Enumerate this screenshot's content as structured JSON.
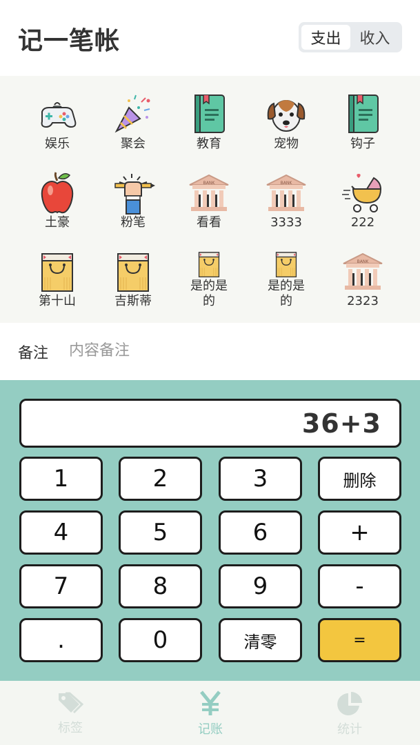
{
  "header": {
    "title": "记一笔帐",
    "toggle": {
      "expense": "支出",
      "income": "收入",
      "active": "expense"
    }
  },
  "categories": [
    {
      "label": "娱乐",
      "icon": "gamepad-icon"
    },
    {
      "label": "聚会",
      "icon": "party-popper-icon"
    },
    {
      "label": "教育",
      "icon": "book-icon"
    },
    {
      "label": "宠物",
      "icon": "dog-icon"
    },
    {
      "label": "钩子",
      "icon": "book-icon"
    },
    {
      "label": "土豪",
      "icon": "apple-icon"
    },
    {
      "label": "粉笔",
      "icon": "hand-pencil-icon"
    },
    {
      "label": "看看",
      "icon": "bank-icon"
    },
    {
      "label": "3333",
      "icon": "bank-icon"
    },
    {
      "label": "222",
      "icon": "stroller-icon"
    },
    {
      "label": "第十山",
      "icon": "shopping-bag-icon"
    },
    {
      "label": "吉斯蒂",
      "icon": "shopping-bag-icon"
    },
    {
      "label": "是的是的",
      "icon": "shopping-bag-icon"
    },
    {
      "label": "是的是的",
      "icon": "shopping-bag-icon"
    },
    {
      "label": "2323",
      "icon": "bank-icon"
    }
  ],
  "remark": {
    "label": "备注",
    "placeholder": "内容备注"
  },
  "keypad": {
    "display": "36+3",
    "keys": [
      "1",
      "2",
      "3",
      "删除",
      "4",
      "5",
      "6",
      "+",
      "7",
      "8",
      "9",
      "-",
      ".",
      "0",
      "清零",
      "="
    ]
  },
  "colors": {
    "accent": "#94cdc2",
    "equals": "#f3c63f"
  },
  "nav": [
    {
      "label": "标签",
      "icon": "tag-icon",
      "active": false
    },
    {
      "label": "记账",
      "icon": "yen-icon",
      "active": true
    },
    {
      "label": "统计",
      "icon": "pie-chart-icon",
      "active": false
    }
  ]
}
